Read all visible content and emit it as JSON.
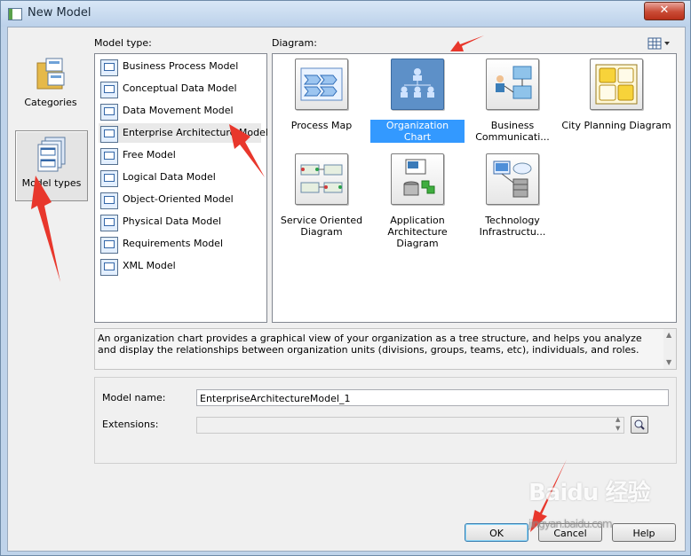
{
  "window": {
    "title": "New Model",
    "close_label": "✕"
  },
  "nav": {
    "items": [
      {
        "label": "Categories",
        "selected": false
      },
      {
        "label": "Model types",
        "selected": true
      }
    ]
  },
  "model_type": {
    "label": "Model type:",
    "items": [
      {
        "label": "Business Process Model"
      },
      {
        "label": "Conceptual Data Model"
      },
      {
        "label": "Data Movement Model"
      },
      {
        "label": "Enterprise Architecture Model",
        "selected": true
      },
      {
        "label": "Free Model"
      },
      {
        "label": "Logical Data Model"
      },
      {
        "label": "Object-Oriented Model"
      },
      {
        "label": "Physical Data Model"
      },
      {
        "label": "Requirements Model"
      },
      {
        "label": "XML Model"
      }
    ]
  },
  "diagram": {
    "label": "Diagram:",
    "items": [
      {
        "label": "Process Map",
        "icon": "process-map-icon"
      },
      {
        "label": "Organization Chart",
        "icon": "organization-chart-icon",
        "selected": true
      },
      {
        "label": "Business Communicati...",
        "icon": "business-communication-icon"
      },
      {
        "label": "City Planning Diagram",
        "icon": "city-planning-icon"
      },
      {
        "label": "Service Oriented Diagram",
        "icon": "service-oriented-icon"
      },
      {
        "label": "Application Architecture Diagram",
        "icon": "application-architecture-icon"
      },
      {
        "label": "Technology Infrastructu...",
        "icon": "technology-infrastructure-icon"
      }
    ]
  },
  "description": "An organization chart provides a graphical view of your organization as a tree structure, and helps you analyze and display the relationships between organization units (divisions, groups, teams, etc), individuals, and roles.",
  "form": {
    "model_name_label": "Model name:",
    "model_name_value": "EnterpriseArchitectureModel_1",
    "extensions_label": "Extensions:",
    "extensions_value": ""
  },
  "buttons": {
    "ok": "OK",
    "cancel": "Cancel",
    "help": "Help"
  },
  "watermark": {
    "text": "Baidu 经验",
    "sub": "jingyan.baidu.com"
  },
  "colors": {
    "selection": "#3399ff",
    "annotation_arrow": "#e8372c"
  }
}
